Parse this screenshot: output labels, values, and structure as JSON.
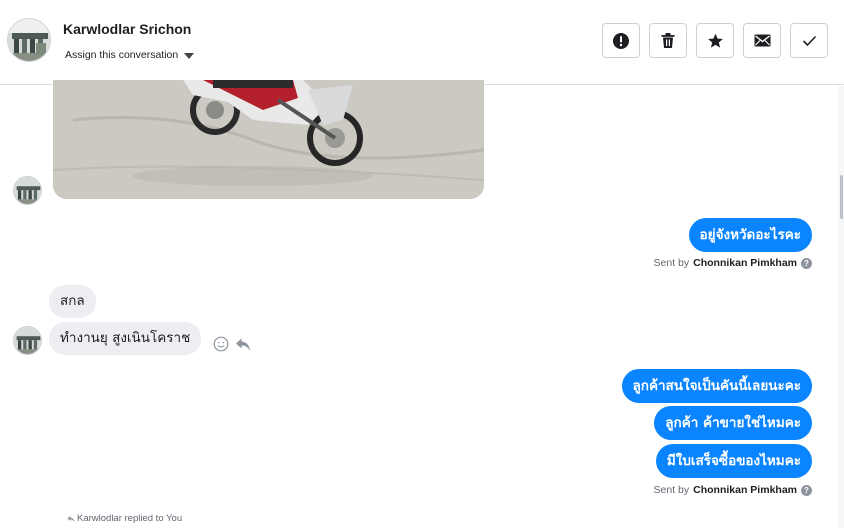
{
  "header": {
    "contact_name": "Karwlodlar Srichon",
    "assign_label": "Assign this conversation",
    "actions": [
      {
        "name": "mark-spam-button",
        "icon": "exclamation-icon"
      },
      {
        "name": "delete-button",
        "icon": "trash-icon"
      },
      {
        "name": "star-button",
        "icon": "star-icon"
      },
      {
        "name": "mark-unread-button",
        "icon": "envelope-icon"
      },
      {
        "name": "mark-done-button",
        "icon": "checkmark-icon"
      }
    ]
  },
  "messages": {
    "outgoing_1": "อยู่จังหวัดอะไรคะ",
    "incoming_1": "สกล",
    "incoming_2": "ทำงานยุ  สูงเนินโคราช",
    "outgoing_2": "ลูกค้าสนใจเป็นคันนี้เลยนะคะ",
    "outgoing_3": "ลูกค้า ค้าขายใช่ไหมคะ",
    "outgoing_4": "มีใบเสร็จซื้อของไหมคะ"
  },
  "sent_by": {
    "prefix": "Sent by",
    "agent": "Chonnikan Pimkham",
    "help_glyph": "?"
  },
  "reply_note": "Karwlodlar replied to You",
  "colors": {
    "accent_blue": "#0a84ff",
    "incoming_bubble": "#eceef1"
  }
}
